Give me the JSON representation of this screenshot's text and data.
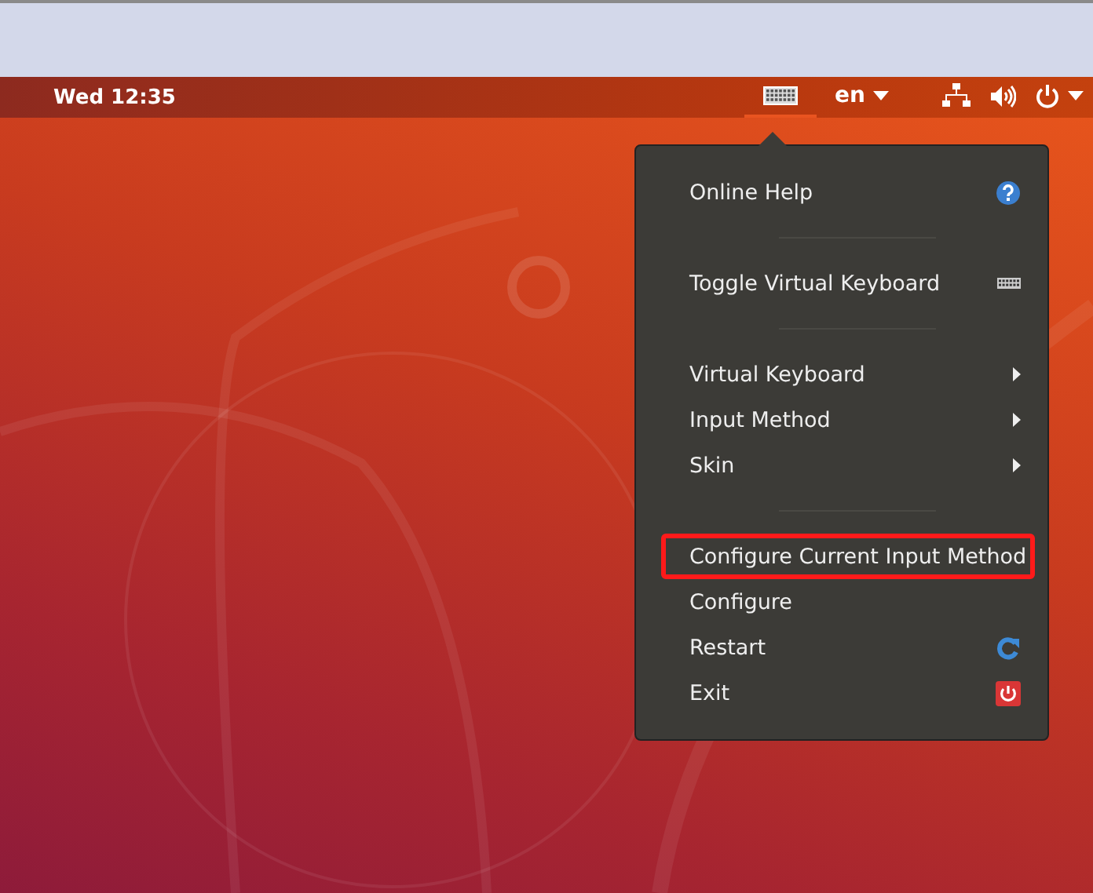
{
  "top_bar": {
    "clock": "Wed 12:35",
    "indicators": [
      {
        "kind": "keyboard",
        "selected": true
      },
      {
        "kind": "language",
        "label": "en",
        "selected": false
      },
      {
        "kind": "network",
        "selected": false
      },
      {
        "kind": "volume",
        "selected": false
      },
      {
        "kind": "power",
        "selected": false
      }
    ]
  },
  "menu": {
    "items": [
      {
        "kind": "help",
        "label": "Online Help",
        "highlighted": false
      },
      {
        "kind": "separator"
      },
      {
        "kind": "keyboard",
        "label": "Toggle Virtual Keyboard",
        "highlighted": false
      },
      {
        "kind": "separator"
      },
      {
        "kind": "submenu",
        "label": "Virtual Keyboard",
        "highlighted": false
      },
      {
        "kind": "submenu",
        "label": "Input Method",
        "highlighted": false
      },
      {
        "kind": "submenu",
        "label": "Skin",
        "highlighted": false
      },
      {
        "kind": "separator"
      },
      {
        "kind": "item",
        "label": "Configure Current Input Method",
        "highlighted": true
      },
      {
        "kind": "item",
        "label": "Configure",
        "highlighted": false
      },
      {
        "kind": "restart",
        "label": "Restart",
        "highlighted": false
      },
      {
        "kind": "exit",
        "label": "Exit",
        "highlighted": false
      }
    ]
  }
}
